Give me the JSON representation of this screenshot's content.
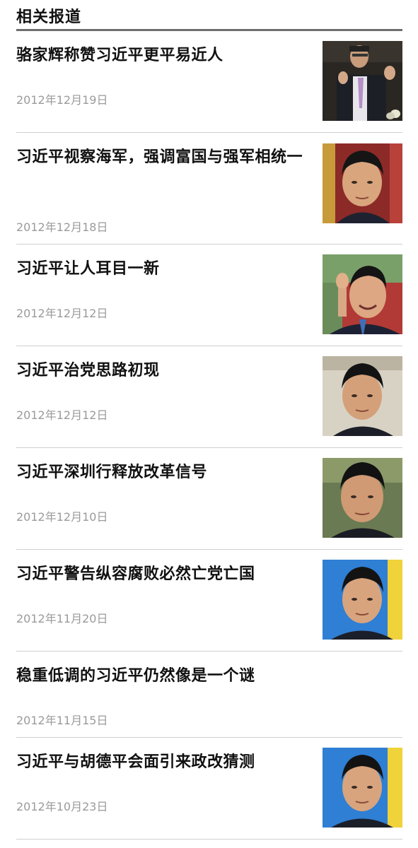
{
  "section": {
    "title": "相关报道"
  },
  "articles": [
    {
      "headline": "骆家辉称赞习近平更平易近人",
      "date": "2012年12月19日",
      "thumbnail": "photo-man-gesturing"
    },
    {
      "headline": "习近平视察海军，强调富国与强军相统一",
      "date": "2012年12月18日",
      "thumbnail": "portrait-photo"
    },
    {
      "headline": "习近平让人耳目一新",
      "date": "2012年12月12日",
      "thumbnail": "portrait-photo-waving"
    },
    {
      "headline": "习近平治党思路初现",
      "date": "2012年12月12日",
      "thumbnail": "portrait-photo"
    },
    {
      "headline": "习近平深圳行释放改革信号",
      "date": "2012年12月10日",
      "thumbnail": "portrait-photo"
    },
    {
      "headline": "习近平警告纵容腐败必然亡党亡国",
      "date": "2012年11月20日",
      "thumbnail": "portrait-photo"
    },
    {
      "headline": "稳重低调的习近平仍然像是一个谜",
      "date": "2012年11月15日",
      "thumbnail": ""
    },
    {
      "headline": "习近平与胡德平会面引来政改猜测",
      "date": "2012年10月23日",
      "thumbnail": "portrait-photo"
    }
  ]
}
